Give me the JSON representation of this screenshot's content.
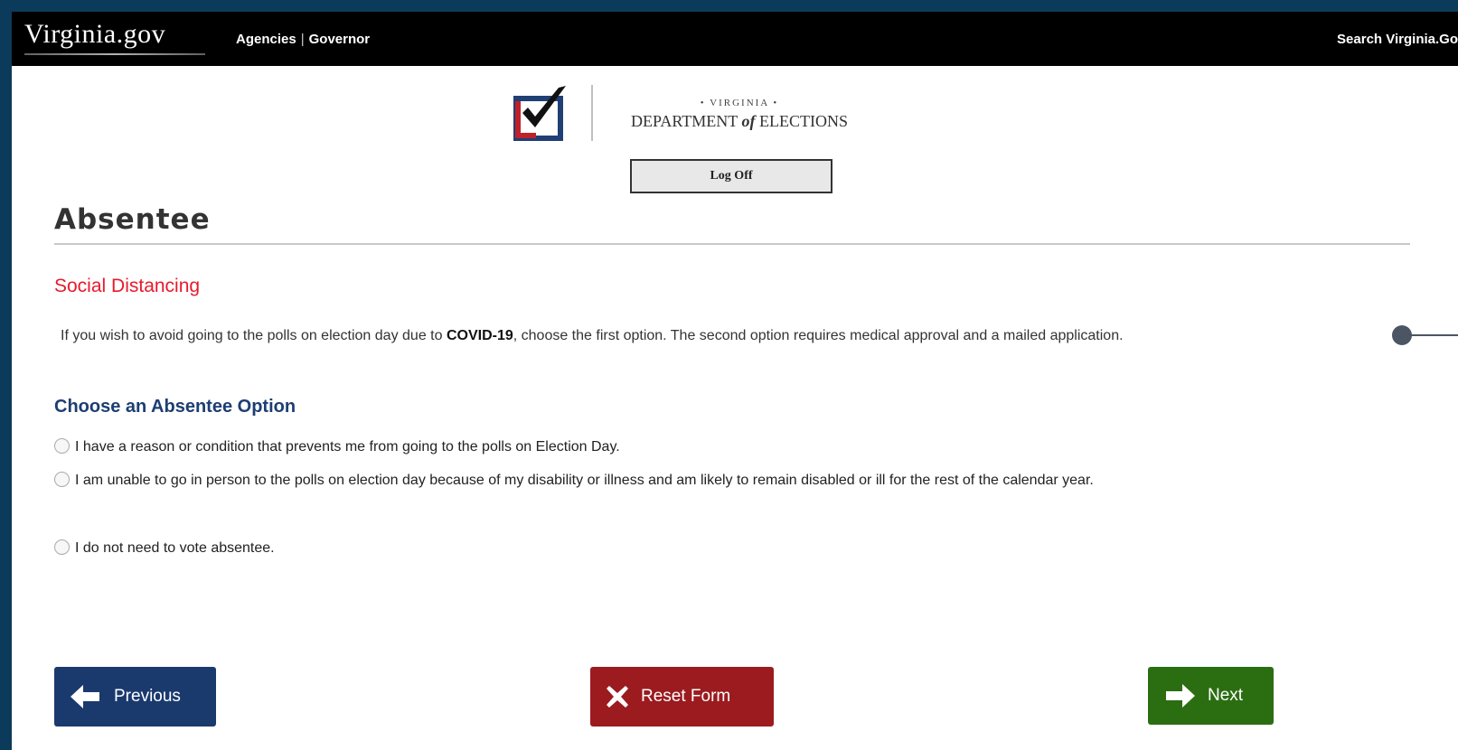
{
  "topbar": {
    "brand": "Virginia.gov",
    "links": [
      "Agencies",
      "Governor"
    ],
    "separator": "|",
    "search_label": "Search Virginia.Go"
  },
  "logo": {
    "subtitle": "• VIRGINIA •",
    "main_before": "DEPARTMENT ",
    "main_of": "of",
    "main_after": " ELECTIONS"
  },
  "logoff_label": "Log Off",
  "page": {
    "title": "Absentee",
    "section_heading": "Social Distancing",
    "info_before": "If you wish to avoid going to the polls on election day due to ",
    "info_bold": "COVID-19",
    "info_after": ", choose the first option. The second option requires medical approval and a mailed application."
  },
  "options": {
    "heading": "Choose an Absentee Option",
    "items": [
      "I have a reason or condition that prevents me from going to the polls on Election Day.",
      "I am unable to go in person to the polls on election day because of my disability or illness and am likely to remain disabled or ill for the rest of the calendar year.",
      "I do not need to vote absentee."
    ]
  },
  "buttons": {
    "previous": "Previous",
    "reset": "Reset Form",
    "next": "Next"
  },
  "colors": {
    "section_heading": "#e8192c",
    "options_heading": "#1d3e72",
    "previous_button": "#1a3a6e",
    "reset_button": "#9b1b1f",
    "next_button": "#2b6e12"
  },
  "icons": {
    "previous": "arrow-left-icon",
    "reset": "x-icon",
    "next": "arrow-right-icon"
  }
}
